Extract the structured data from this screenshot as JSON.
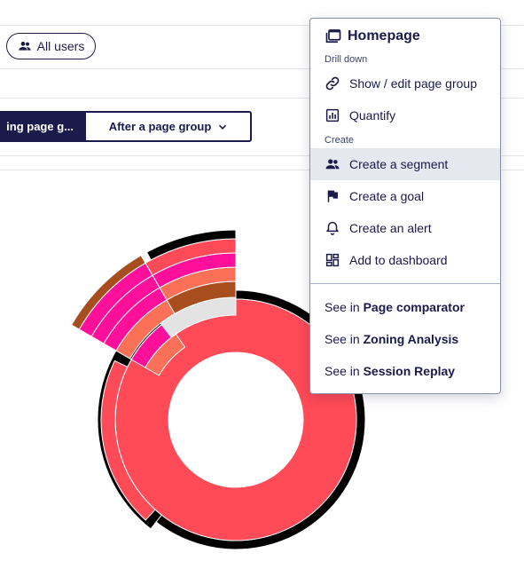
{
  "filters": {
    "users_label": "All users"
  },
  "segments": [
    {
      "label": "ing page g...",
      "active": true
    },
    {
      "label": "After a page group",
      "active": false
    }
  ],
  "menu": {
    "title": "Homepage",
    "drill_down_label": "Drill down",
    "drill_down_items": [
      {
        "label": "Show / edit page group",
        "icon": "link-icon"
      },
      {
        "label": "Quantify",
        "icon": "bar-chart-icon"
      }
    ],
    "create_label": "Create",
    "create_items": [
      {
        "label": "Create a segment",
        "icon": "users-icon",
        "highlighted": true
      },
      {
        "label": "Create a goal",
        "icon": "flag-icon"
      },
      {
        "label": "Create an alert",
        "icon": "bell-icon"
      },
      {
        "label": "Add to dashboard",
        "icon": "dashboard-icon"
      }
    ],
    "see_in_prefix": "See in",
    "see_items": [
      {
        "label": "Page comparator"
      },
      {
        "label": "Zoning Analysis"
      },
      {
        "label": "Session Replay"
      }
    ]
  },
  "colors": {
    "navy": "#1a1a4b",
    "coral": "#ff4a57",
    "pink": "#ff0f9a",
    "salmon": "#fb7157",
    "brown": "#a84d1e",
    "grey": "#e3e3e3",
    "black": "#000000",
    "highlight": "#e5e8ef"
  }
}
